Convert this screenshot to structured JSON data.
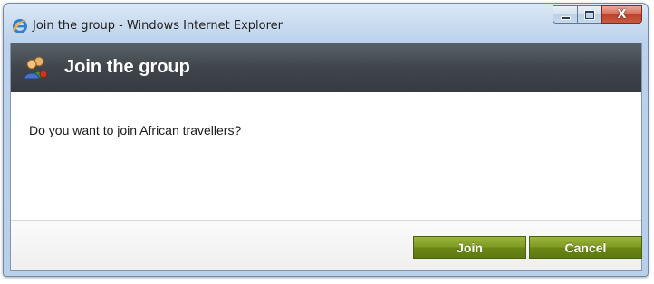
{
  "window": {
    "title": "Join the group - Windows Internet Explorer",
    "icon": "internet-explorer-icon",
    "caption_buttons": [
      "minimize-icon",
      "maximize-icon",
      "close-icon"
    ],
    "close_glyph": "X"
  },
  "dialog": {
    "title": "Join the group",
    "icon": "group-users-icon",
    "message": "Do you want to join African travellers?"
  },
  "buttons": {
    "join_label": "Join",
    "cancel_label": "Cancel"
  },
  "colors": {
    "header_bg": "#3f454b",
    "button_green": "#7e9b22",
    "close_red": "#c0412b"
  }
}
